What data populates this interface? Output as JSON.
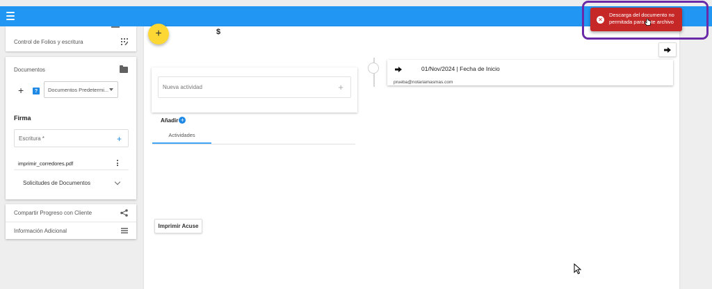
{
  "left_panel": {
    "folios_label": "Control de Folios y escritura",
    "documentos": {
      "title": "Documentos",
      "select_value": "Documentos Predetermi...",
      "help_label": "?"
    },
    "firma": {
      "title": "Firma",
      "escritura_label": "Escritura *",
      "file_name": "imprimir_corredores.pdf",
      "solicitudes_label": "Solicitudes de Documentos"
    },
    "share_label": "Compartir Progreso con Cliente",
    "info_label": "Información Adicional"
  },
  "main": {
    "currency_symbol": "$",
    "nueva_actividad_placeholder": "Nueva actividad",
    "anadir_label": "Añadir",
    "tab_actividades": "Actividades",
    "imprimir_acuse_label": "Imprimir Acuse"
  },
  "timeline": {
    "date_text": "01/Nov/2024 | Fecha de Inicio",
    "email": "prueba@notariamasmas.com"
  },
  "toast": {
    "message": "Descarga del documento no permitada para este archivo"
  },
  "colors": {
    "topbar": "#2196f3",
    "fab": "#fdd835",
    "toast": "#c62828",
    "highlight": "#6a2aa8",
    "accent": "#1e88e5"
  }
}
